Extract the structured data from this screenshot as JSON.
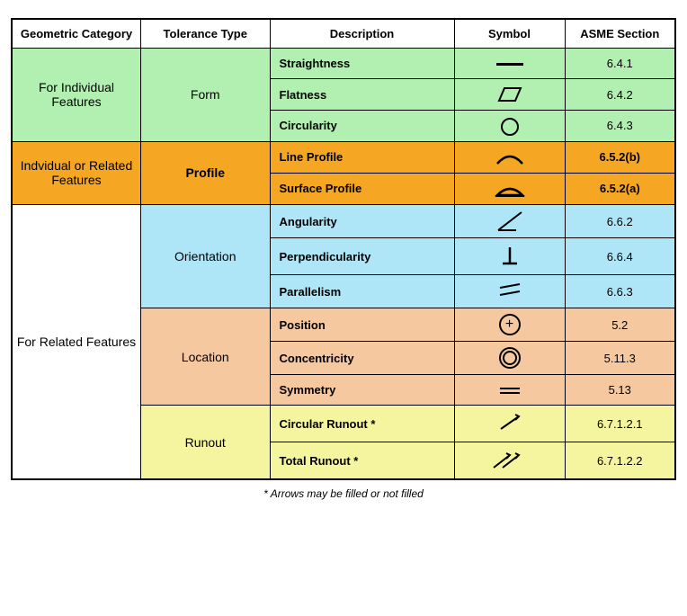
{
  "headers": {
    "category": "Geometric Category",
    "tolerance": "Tolerance Type",
    "description": "Description",
    "symbol": "Symbol",
    "asme": "ASME Section"
  },
  "rows": [
    {
      "category": "For Individual Features",
      "tolerance": "Form",
      "items": [
        {
          "description": "Straightness",
          "asme": "6.4.1"
        },
        {
          "description": "Flatness",
          "asme": "6.4.2"
        },
        {
          "description": "Circularity",
          "asme": "6.4.3"
        }
      ]
    },
    {
      "category": "Indvidual or Related Features",
      "tolerance": "Profile",
      "items": [
        {
          "description": "Line Profile",
          "asme": "6.5.2(b)"
        },
        {
          "description": "Surface Profile",
          "asme": "6.5.2(a)"
        }
      ]
    },
    {
      "category": "For Related Features",
      "tolerance_groups": [
        {
          "name": "Orientation",
          "items": [
            {
              "description": "Angularity",
              "asme": "6.6.2"
            },
            {
              "description": "Perpendicularity",
              "asme": "6.6.4"
            },
            {
              "description": "Parallelism",
              "asme": "6.6.3"
            }
          ]
        },
        {
          "name": "Location",
          "items": [
            {
              "description": "Position",
              "asme": "5.2"
            },
            {
              "description": "Concentricity",
              "asme": "5.11.3"
            },
            {
              "description": "Symmetry",
              "asme": "5.13"
            }
          ]
        },
        {
          "name": "Runout",
          "items": [
            {
              "description": "Circular Runout *",
              "asme": "6.7.1.2.1"
            },
            {
              "description": "Total Runout *",
              "asme": "6.7.1.2.2"
            }
          ]
        }
      ]
    }
  ],
  "footnote": "* Arrows may be filled or not filled"
}
